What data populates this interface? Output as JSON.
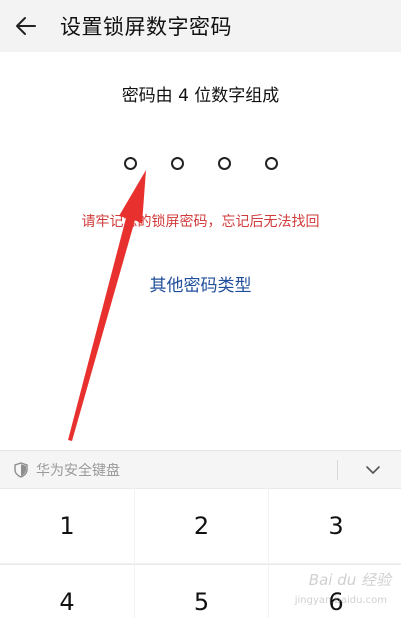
{
  "header": {
    "title": "设置锁屏数字密码",
    "back_icon": "arrow-left-icon"
  },
  "main": {
    "hint": "密码由 4 位数字组成",
    "pin_length": 4,
    "pin_filled": 0,
    "warning": "请牢记您的锁屏密码，忘记后无法找回",
    "other_type_link": "其他密码类型"
  },
  "keyboard": {
    "label": "华为安全键盘",
    "shield_icon": "shield-icon",
    "collapse_icon": "chevron-down-icon",
    "keys": [
      "1",
      "2",
      "3",
      "4",
      "5",
      "6"
    ]
  },
  "annotation": {
    "arrow_color": "#e8312f"
  },
  "watermark": {
    "text": "Bai du 经验",
    "sub": "jingyan.baidu.com"
  },
  "colors": {
    "header_bg": "#f3f3f3",
    "warning": "#d23b3b",
    "link": "#1f4e9b"
  }
}
